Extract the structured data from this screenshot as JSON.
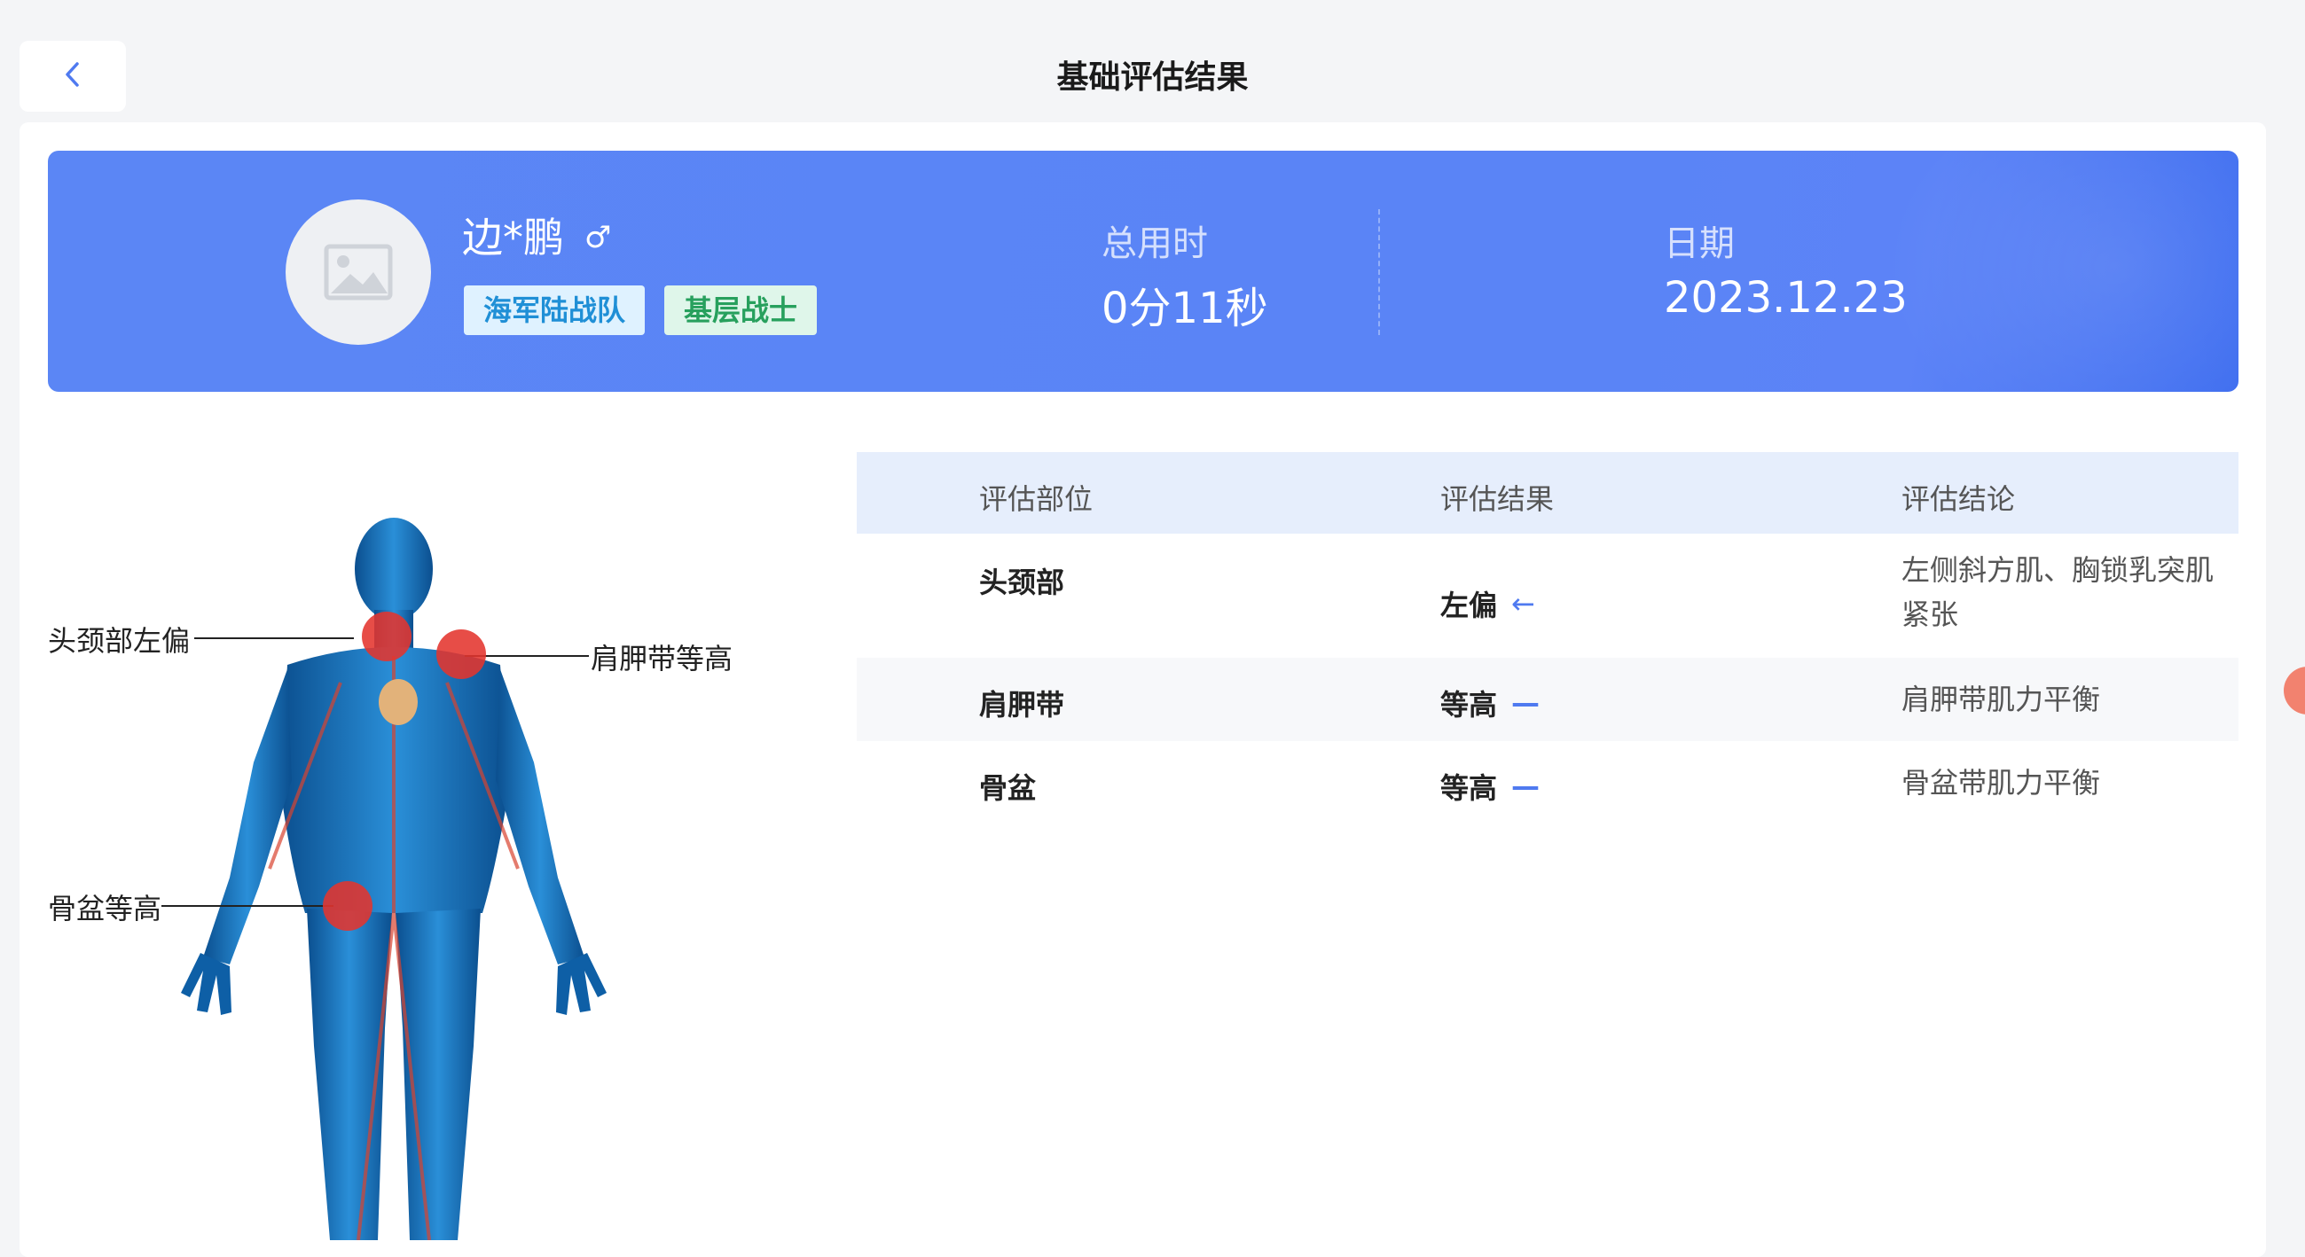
{
  "header": {
    "title": "基础评估结果",
    "back_icon": "chevron-left-icon"
  },
  "profile": {
    "name": "边*鹏",
    "gender_symbol": "♂",
    "tags": [
      "海军陆战队",
      "基层战士"
    ],
    "total_time_label": "总用时",
    "total_time_value": "0分11秒",
    "date_label": "日期",
    "date_value": "2023.12.23"
  },
  "body_callouts": {
    "head": "头颈部左偏",
    "shoulder": "肩胛带等高",
    "pelvis": "骨盆等高"
  },
  "table": {
    "headers": [
      "评估部位",
      "评估结果",
      "评估结论"
    ],
    "rows": [
      {
        "part": "头颈部",
        "result": "左偏",
        "indicator": "←",
        "conclusion_line1": "左侧斜方肌、胸锁乳突肌",
        "conclusion_line2": "紧张"
      },
      {
        "part": "肩胛带",
        "result": "等高",
        "indicator": "—",
        "conclusion_line1": "肩胛带肌力平衡"
      },
      {
        "part": "骨盆",
        "result": "等高",
        "indicator": "—",
        "conclusion_line1": "骨盆带肌力平衡"
      }
    ]
  },
  "colors": {
    "accent": "#5a84f6",
    "marker": "#e4342d",
    "indicator": "#4f7af0"
  }
}
